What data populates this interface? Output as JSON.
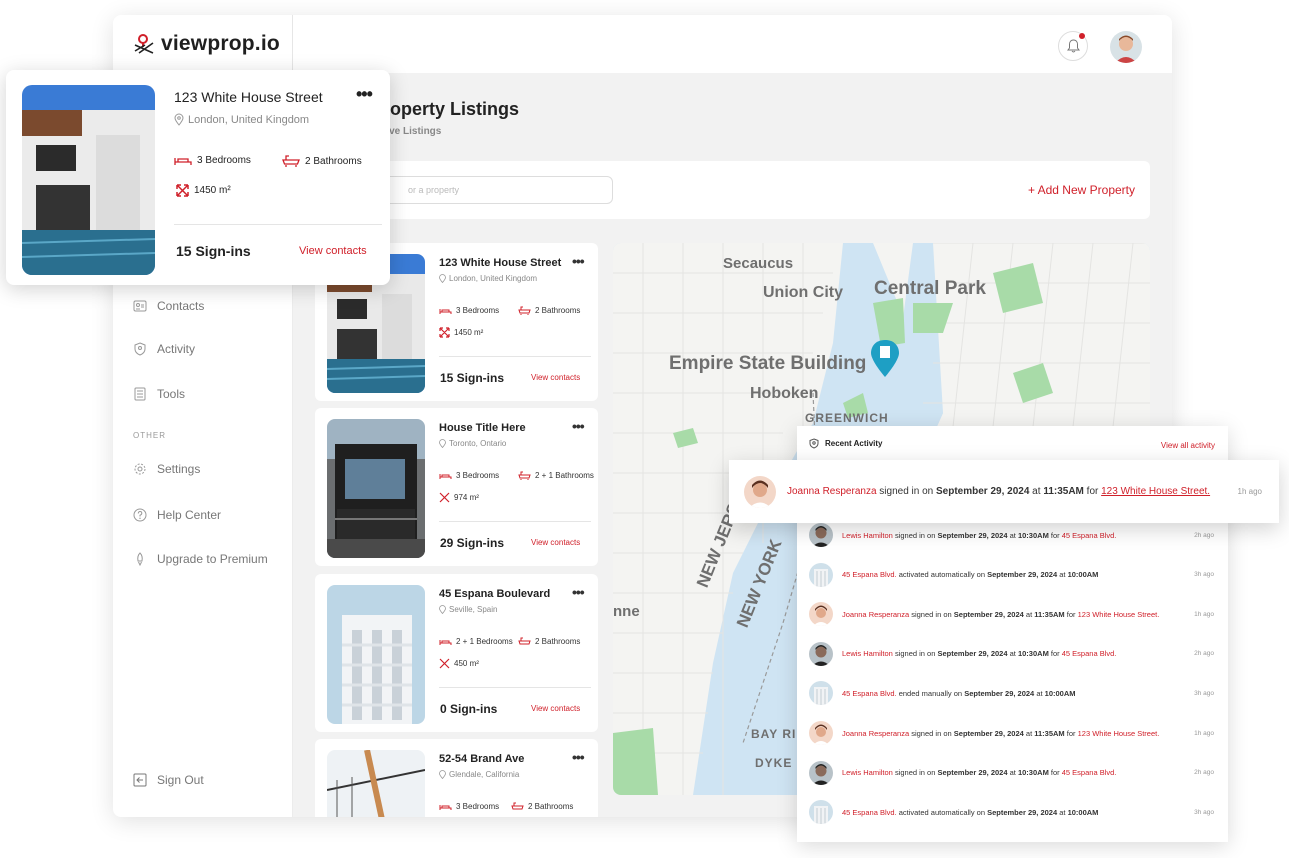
{
  "app": {
    "logo": "viewprop.io"
  },
  "sidebar": {
    "items": [
      {
        "label": "Contacts",
        "icon": "contacts-icon"
      },
      {
        "label": "Activity",
        "icon": "activity-icon"
      },
      {
        "label": "Tools",
        "icon": "tools-icon"
      }
    ],
    "section_other": "OTHER",
    "other_items": [
      {
        "label": "Settings",
        "icon": "gear-icon"
      },
      {
        "label": "Help Center",
        "icon": "help-icon"
      },
      {
        "label": "Upgrade to Premium",
        "icon": "rocket-icon"
      }
    ],
    "sign_out": "Sign Out"
  },
  "main": {
    "title": "roperty Listings",
    "subtitle": "tive Listings",
    "search_placeholder": "or a property",
    "add_button": "+ Add New Property"
  },
  "featured": {
    "title": "123 White House Street",
    "location": "London, United Kingdom",
    "bedrooms": "3 Bedrooms",
    "bathrooms": "2 Bathrooms",
    "area": "1450 m²",
    "signins": "15 Sign-ins",
    "contacts": "View contacts"
  },
  "listings": [
    {
      "title": "123 White House Street",
      "location": "London, United Kingdom",
      "bedrooms": "3 Bedrooms",
      "bathrooms": "2 Bathrooms",
      "area": "1450 m²",
      "signins": "15 Sign-ins",
      "contacts": "View contacts"
    },
    {
      "title": "House Title Here",
      "location": "Toronto, Ontario",
      "bedrooms": "3 Bedrooms",
      "bathrooms": "2 + 1 Bathrooms",
      "area": "974 m²",
      "signins": "29 Sign-ins",
      "contacts": "View contacts"
    },
    {
      "title": "45 Espana Boulevard",
      "location": "Seville, Spain",
      "bedrooms": "2 + 1 Bedrooms",
      "bathrooms": "2 Bathrooms",
      "area": "450 m²",
      "signins": "0 Sign-ins",
      "contacts": "View contacts"
    },
    {
      "title": "52-54 Brand Ave",
      "location": "Glendale, California",
      "bedrooms": "3 Bedrooms",
      "bathrooms": "2 Bathrooms",
      "area": "",
      "signins": "",
      "contacts": ""
    }
  ],
  "map": {
    "labels": [
      "Secaucus",
      "Union City",
      "Central Park",
      "Empire State Building",
      "Hoboken",
      "GREENWICH",
      "NEW JERSEY",
      "NEW YORK",
      "nne",
      "BAY RI",
      "DYKE"
    ]
  },
  "activity": {
    "title": "Recent Activity",
    "view_all": "View all activity",
    "highlight": {
      "name": "Joanna Resperanza",
      "mid": " signed in on ",
      "date": "September 29, 2024",
      "at": " at ",
      "time_of": "11:35AM",
      "for": " for ",
      "property": "123 White House Street.",
      "ago": "1h ago"
    },
    "rows": [
      {
        "avatar": "man",
        "lead": "Lewis Hamilton",
        "mid": " signed in on ",
        "date": "September 29, 2024",
        "at": " at ",
        "time_of": "10:30AM",
        "for": " for ",
        "property": "45 Espana Blvd.",
        "ago": "2h ago"
      },
      {
        "avatar": "building",
        "lead": "45 Espana Blvd.",
        "mid": " activated automatically on ",
        "date": "September 29, 2024",
        "at": " at ",
        "time_of": "10:00AM",
        "for": "",
        "property": "",
        "ago": "3h ago"
      },
      {
        "avatar": "woman",
        "lead": "Joanna Resperanza",
        "mid": " signed in on ",
        "date": "September 29, 2024",
        "at": " at ",
        "time_of": "11:35AM",
        "for": " for ",
        "property": "123 White House Street.",
        "ago": "1h ago"
      },
      {
        "avatar": "man",
        "lead": "Lewis Hamilton",
        "mid": " signed in on ",
        "date": "September 29, 2024",
        "at": " at ",
        "time_of": "10:30AM",
        "for": " for ",
        "property": "45 Espana Blvd.",
        "ago": "2h ago"
      },
      {
        "avatar": "building",
        "lead": "45 Espana Blvd.",
        "mid": " ended manually on ",
        "date": "September 29, 2024",
        "at": " at ",
        "time_of": "10:00AM",
        "for": "",
        "property": "",
        "ago": "3h ago"
      },
      {
        "avatar": "woman",
        "lead": "Joanna Resperanza",
        "mid": " signed in on ",
        "date": "September 29, 2024",
        "at": " at ",
        "time_of": "11:35AM",
        "for": " for ",
        "property": "123 White House Street.",
        "ago": "1h ago"
      },
      {
        "avatar": "man",
        "lead": "Lewis Hamilton",
        "mid": " signed in on ",
        "date": "September 29, 2024",
        "at": " at ",
        "time_of": "10:30AM",
        "for": " for ",
        "property": "45 Espana Blvd.",
        "ago": "2h ago"
      },
      {
        "avatar": "building",
        "lead": "45 Espana Blvd.",
        "mid": " activated automatically on ",
        "date": "September 29, 2024",
        "at": " at ",
        "time_of": "10:00AM",
        "for": "",
        "property": "",
        "ago": "3h ago"
      }
    ]
  },
  "colors": {
    "accent": "#d0202a",
    "map_water": "#cfe4f3",
    "map_land": "#f4f4f2",
    "park": "#a8dba8",
    "pin": "#1e9fc4"
  }
}
